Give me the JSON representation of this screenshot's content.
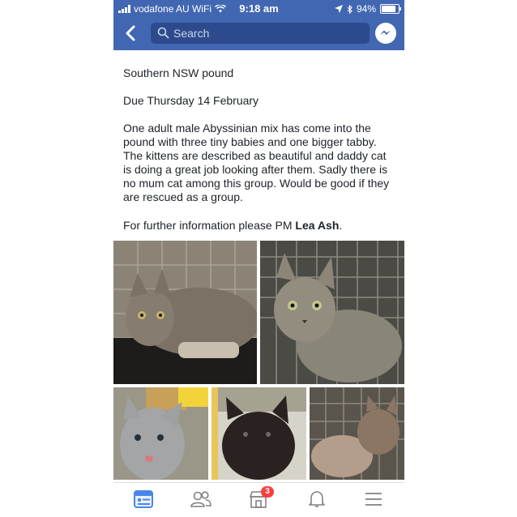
{
  "status_bar": {
    "carrier": "vodafone AU WiFi",
    "time": "9:18 am",
    "battery_percent": "94%",
    "battery_level": 0.94
  },
  "nav": {
    "search_placeholder": "Search",
    "back_icon": "chevron-left-icon",
    "messenger_icon": "messenger-icon"
  },
  "post": {
    "location": "Southern NSW pound",
    "due": "Due Thursday 14 February",
    "description_lines": [
      "One adult male Abyssinian mix has come into the",
      "pound with three tiny babies and one bigger tabby.",
      "The kittens are described as beautiful and daddy cat",
      "is doing a great job looking after them. Sadly there is",
      "no mum cat among this group. Would be good if they",
      "are rescued as a group."
    ],
    "contact_prefix": "For further information please PM ",
    "contact_name": "Lea Ash",
    "contact_suffix": "."
  },
  "photos": [
    {
      "subject": "tabby-cat-photo"
    },
    {
      "subject": "tabby-kitten-photo"
    },
    {
      "subject": "grey-kitten-photo"
    },
    {
      "subject": "black-kitten-photo"
    },
    {
      "subject": "sleeping-kittens-photo"
    }
  ],
  "tabbar": {
    "items": [
      {
        "icon": "news-feed-icon",
        "active": true
      },
      {
        "icon": "friends-icon",
        "active": false
      },
      {
        "icon": "marketplace-icon",
        "active": false,
        "badge": "3"
      },
      {
        "icon": "bell-icon",
        "active": false
      },
      {
        "icon": "menu-icon",
        "active": false
      }
    ]
  },
  "colors": {
    "brand_blue": "#4267b2",
    "search_bg": "#2d4b8c",
    "badge_red": "#fa3e3e",
    "text": "#1d2129"
  }
}
